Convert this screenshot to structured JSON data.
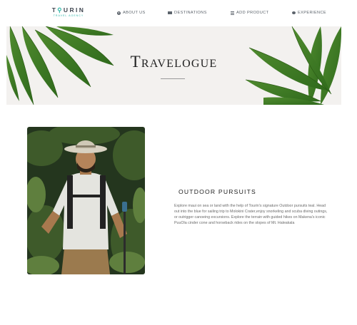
{
  "nav": {
    "logo_word_a": "T",
    "logo_word_pin": "⚲",
    "logo_word_b": "URIN",
    "logo_sub": "TRAVEL AGENCY",
    "items": [
      {
        "label": "ABOUT US",
        "icon": "compass-icon"
      },
      {
        "label": "DESTINATIONS",
        "icon": "map-icon"
      },
      {
        "label": "ADD PRODUCT",
        "icon": "list-icon"
      },
      {
        "label": "EXPERIENCE",
        "icon": "chat-icon"
      }
    ]
  },
  "hero": {
    "title": "Travelogue"
  },
  "feature": {
    "title": "OUTDOOR PURSUITS",
    "body": "Explore maui on sea or land with the help of Tourin's signature Outdoor pursuits teal. Head out into the blue for sailing trip to Molokini Crater,enjoy snorkeling and scuba diving outings, or outrigger canoeing excursions. Explore the terrain with guided hikes on Makena's iconic PuuOla cinder cone and horseback rides on the slopes of Mt. Haleakala"
  }
}
